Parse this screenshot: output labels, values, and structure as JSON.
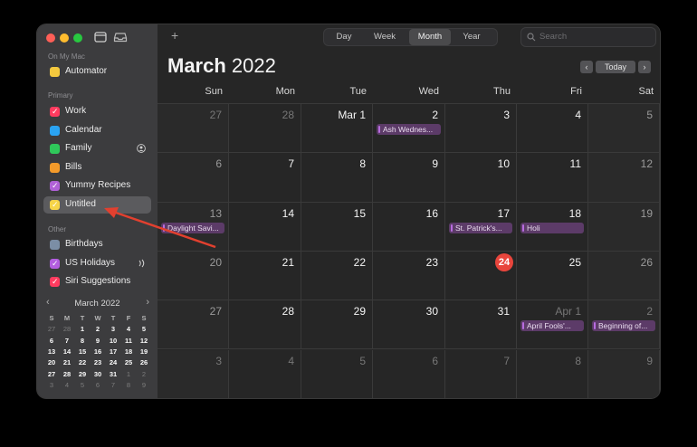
{
  "toolbar": {
    "views": [
      "Day",
      "Week",
      "Month",
      "Year"
    ],
    "active_view": "Month",
    "search_placeholder": "Search",
    "add_label": "+"
  },
  "sidebar": {
    "sections": [
      {
        "header": "On My Mac",
        "items": [
          {
            "label": "Automator",
            "color": "#f3c83e",
            "checked": false
          }
        ]
      },
      {
        "header": "Primary",
        "items": [
          {
            "label": "Work",
            "color": "#ff3b5f",
            "checked": true
          },
          {
            "label": "Calendar",
            "color": "#2aa3f2",
            "checked": false
          },
          {
            "label": "Family",
            "color": "#2fc85a",
            "checked": false,
            "shared": true
          },
          {
            "label": "Bills",
            "color": "#f39a2a",
            "checked": false
          },
          {
            "label": "Yummy Recipes",
            "color": "#b061d7",
            "checked": true
          },
          {
            "label": "Untitled",
            "color": "#f6d448",
            "checked": true,
            "selected": true
          }
        ]
      },
      {
        "header": "Other",
        "items": [
          {
            "label": "Birthdays",
            "color": "#7b8ea5",
            "checked": false
          },
          {
            "label": "US Holidays",
            "color": "#b35ee0",
            "checked": true,
            "broadcast": true
          },
          {
            "label": "Siri Suggestions",
            "color": "#ff3b5f",
            "checked": true
          }
        ]
      }
    ]
  },
  "mini_calendar": {
    "title": "March 2022",
    "prev": "‹",
    "next": "›",
    "weekdays": [
      "S",
      "M",
      "T",
      "W",
      "T",
      "F",
      "S"
    ],
    "weeks": [
      [
        "27",
        "28",
        "1",
        "2",
        "3",
        "4",
        "5"
      ],
      [
        "6",
        "7",
        "8",
        "9",
        "10",
        "11",
        "12"
      ],
      [
        "13",
        "14",
        "15",
        "16",
        "17",
        "18",
        "19"
      ],
      [
        "20",
        "21",
        "22",
        "23",
        "24",
        "25",
        "26"
      ],
      [
        "27",
        "28",
        "29",
        "30",
        "31",
        "1",
        "2"
      ],
      [
        "3",
        "4",
        "5",
        "6",
        "7",
        "8",
        "9"
      ]
    ],
    "today": "24"
  },
  "calendar": {
    "month_name": "March",
    "year": "2022",
    "today_button": "Today",
    "prev": "‹",
    "next": "›",
    "weekdays": [
      "Sun",
      "Mon",
      "Tue",
      "Wed",
      "Thu",
      "Fri",
      "Sat"
    ],
    "weeks": [
      [
        {
          "d": "27",
          "dim": true
        },
        {
          "d": "28",
          "dim": true
        },
        {
          "d": "Mar 1"
        },
        {
          "d": "2",
          "events": [
            "Ash Wednes..."
          ]
        },
        {
          "d": "3"
        },
        {
          "d": "4"
        },
        {
          "d": "5"
        }
      ],
      [
        {
          "d": "6"
        },
        {
          "d": "7"
        },
        {
          "d": "8"
        },
        {
          "d": "9"
        },
        {
          "d": "10"
        },
        {
          "d": "11"
        },
        {
          "d": "12"
        }
      ],
      [
        {
          "d": "13",
          "events": [
            "Daylight Savi..."
          ]
        },
        {
          "d": "14"
        },
        {
          "d": "15"
        },
        {
          "d": "16"
        },
        {
          "d": "17",
          "events": [
            "St. Patrick's..."
          ]
        },
        {
          "d": "18",
          "events": [
            "Holi"
          ]
        },
        {
          "d": "19"
        }
      ],
      [
        {
          "d": "20"
        },
        {
          "d": "21"
        },
        {
          "d": "22"
        },
        {
          "d": "23"
        },
        {
          "d": "24",
          "today": true
        },
        {
          "d": "25"
        },
        {
          "d": "26"
        }
      ],
      [
        {
          "d": "27"
        },
        {
          "d": "28"
        },
        {
          "d": "29"
        },
        {
          "d": "30"
        },
        {
          "d": "31"
        },
        {
          "d": "Apr 1",
          "dim": true,
          "events": [
            "April Fools'..."
          ]
        },
        {
          "d": "2",
          "dim": true,
          "events": [
            "Beginning of..."
          ]
        }
      ],
      [
        {
          "d": "3",
          "dim": true
        },
        {
          "d": "4",
          "dim": true
        },
        {
          "d": "5",
          "dim": true
        },
        {
          "d": "6",
          "dim": true
        },
        {
          "d": "7",
          "dim": true
        },
        {
          "d": "8",
          "dim": true
        },
        {
          "d": "9",
          "dim": true
        }
      ]
    ]
  },
  "colors": {
    "accent_today": "#e8453c",
    "event_bg": "#5c3b68",
    "annotation_arrow": "#e2402f"
  }
}
